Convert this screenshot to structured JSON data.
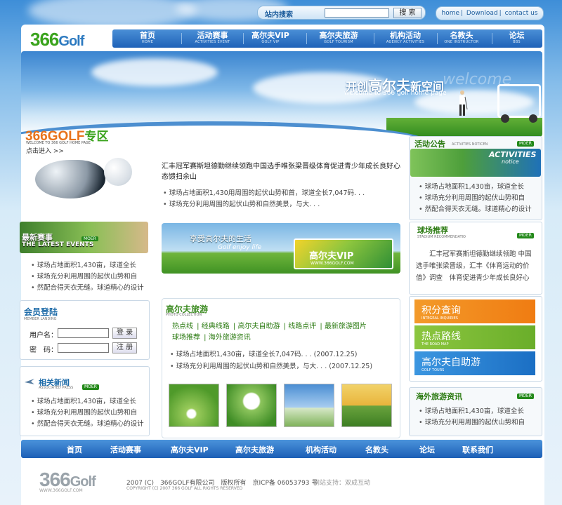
{
  "search": {
    "label": "站内搜索",
    "button": "搜 索"
  },
  "toplinks": [
    "home",
    "Download",
    "contact us"
  ],
  "logo": {
    "num": "366",
    "word": "Golf"
  },
  "nav": [
    {
      "cn": "首页",
      "en": "HOME"
    },
    {
      "cn": "活动赛事",
      "en": "ACTIVITIES EVENT"
    },
    {
      "cn": "高尔夫VIP",
      "en": "GOLF VIP"
    },
    {
      "cn": "高尔夫旅游",
      "en": "GOLF TOURISM"
    },
    {
      "cn": "机构活动",
      "en": "AGENCY ACTIVITIES"
    },
    {
      "cn": "名教头",
      "en": "ONE INSTRUCTOR"
    },
    {
      "cn": "论坛",
      "en": "BBS"
    }
  ],
  "banner": {
    "title_pre": "开创",
    "title_big": "高尔夫",
    "title_post": "新空间",
    "subtitle": "welcome to 366 golf home page",
    "ghost": "welcome"
  },
  "zone": {
    "title": "366GOLF",
    "title_cn": "专区",
    "en": "WELCOME TO 366 GOLF HOME PAGE",
    "enter": "点击进入 >>"
  },
  "news": {
    "headline": "汇丰冠军赛斯坦德勤继续领跑中国选手唯张梁晋级体育促进青少年成长良好心态馈扫余山",
    "items": [
      "球场占地面积1,430用周围的起伏山势和首，球道全长7,047码. . .",
      "球场充分利用周围的起伏山势和自然美景，与大. . ."
    ]
  },
  "events": {
    "title1": "最新赛事",
    "title2": "THE LATEST EVENTS",
    "more": "MOER",
    "items": [
      "球场占地面积1,430亩，球道全长",
      "球场充分利用周围的起伏山势和自",
      "然配合得天衣无缝。球道精心的设计"
    ]
  },
  "login": {
    "title": "会员登陆",
    "en": "MEMBER LANDING",
    "user": "用户名：",
    "pass": "密　码：",
    "login_btn": "登 录",
    "register_btn": "注 册"
  },
  "related": {
    "title": "相关新闻",
    "en": "ASSOCIATED PRESS",
    "more": "MOER",
    "items": [
      "球场占地面积1,430亩，球道全长",
      "球场充分利用周围的起伏山势和自",
      "然配合得天衣无缝。球道精心的设计"
    ]
  },
  "enjoy": {
    "line1": "享受高尔夫的生活",
    "line2": "Golf enjoy life",
    "vip": "高尔夫VIP",
    "vip_url": "WWW.366GOLF.COM"
  },
  "tour": {
    "title": "高尔夫旅游",
    "en": "PHOTO COLLECTION",
    "links": [
      "热点线",
      "经典线路",
      "高尔夫自助游",
      "线路点评",
      "最新旅游图片",
      "球场推荐",
      "海外旅游资讯"
    ],
    "items": [
      "球场占地面积1,430亩，球道全长7,047码. . . (2007.12.25)",
      "球场充分利用周围的起伏山势和自然美景，与大. . . (2007.12.25)"
    ]
  },
  "activity": {
    "title": "活动公告",
    "en": "ACTIVITIES NOTICEN",
    "more": "MOER",
    "img_t": "ACTIVITIES",
    "img_n": "notice",
    "items": [
      "球场占地面积1,430亩，球道全长",
      "球场充分利用周围的起伏山势和自",
      "然配合得天衣无缝。球道精心的设计"
    ]
  },
  "stadium": {
    "title": "球场推荐",
    "en": "STADIUM RECOMMENDATIO",
    "more": "MOER",
    "text": "汇丰冠军赛斯坦德勤继续领跑 中国选手唯张梁晋级，汇丰《体育运动的价值》调查　体育促进青少年成长良好心"
  },
  "buttons": [
    {
      "cn": "积分查询",
      "en": "INTEGRAL INQUIRIES",
      "color": "#f08a1c"
    },
    {
      "cn": "热点路线",
      "en": "THE ROAD MAP",
      "color": "#7cbf2f"
    },
    {
      "cn": "高尔夫自助游",
      "en": "GOLF TOURS",
      "color": "#2a86d8"
    }
  ],
  "overseas": {
    "title": "海外旅游资讯",
    "more": "MOER",
    "items": [
      "球场占地面积1,430亩，球道全长",
      "球场充分利用周围的起伏山势和自"
    ]
  },
  "footer_nav": [
    "首页",
    "活动赛事",
    "高尔夫VIP",
    "高尔夫旅游",
    "机构活动",
    "名教头",
    "论坛",
    "联系我们"
  ],
  "footer": {
    "logo_num": "366",
    "logo_word": "Golf",
    "url": "WWW.366GOLF.COM",
    "copy1": "2007 (C)　366GOLF有限公司　版权所有　京ICP备 06053793 号",
    "copy2": "COPYRIGHT (C) 2007 366 GOLF ALL RIGHTS RESERVED",
    "support": "网站支持：双成互动"
  },
  "colors": {
    "brand_green": "#3aa31c",
    "nav_blue": "#1f62b8",
    "accent_orange": "#e8731b"
  }
}
